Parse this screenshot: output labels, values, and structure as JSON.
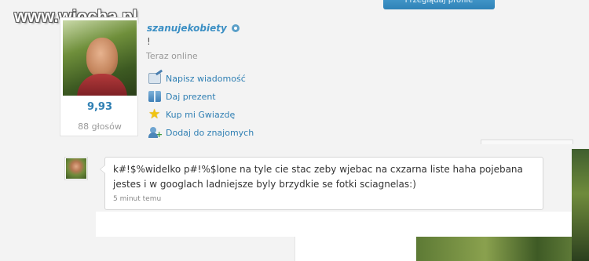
{
  "watermark": {
    "text": "www.wiocha.pl"
  },
  "top_button": {
    "label": "Przeglądaj profile"
  },
  "profile": {
    "username": "szanujekobiety",
    "status_mark": "!",
    "online_status": "Teraz online",
    "rating": "9,93",
    "votes": "88 głosów"
  },
  "actions": [
    {
      "label": "Napisz wiadomość",
      "icon": "envelope-pencil-icon"
    },
    {
      "label": "Daj prezent",
      "icon": "gift-icon"
    },
    {
      "label": "Kup mi Gwiazdę",
      "icon": "star-icon"
    },
    {
      "label": "Dodaj do znajomych",
      "icon": "add-friend-icon"
    }
  ],
  "comment": {
    "text": "k#!$%widelko p#!%$lone na tyle cie stac zeby wjebac na cxzarna liste haha pojebana jestes i w googlach ladniejsze byly brzydkie se fotki sciagnelas:)",
    "time": "5 minut temu"
  },
  "colors": {
    "link": "#2f7fb3",
    "username": "#3b8fc4",
    "button": "#2f82b7"
  }
}
